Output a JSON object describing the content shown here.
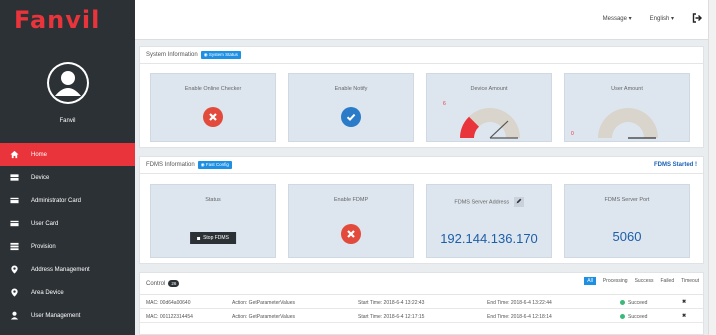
{
  "brand": {
    "logo": "Fanvil",
    "accent": "#e8343a",
    "sidebar_bg": "#2c3136"
  },
  "user": {
    "name": "Fanvil"
  },
  "nav": [
    {
      "label": "Home",
      "icon": "home-icon",
      "active": true
    },
    {
      "label": "Device",
      "icon": "device-icon"
    },
    {
      "label": "Administrator Card",
      "icon": "card-icon"
    },
    {
      "label": "User Card",
      "icon": "card-icon"
    },
    {
      "label": "Provision",
      "icon": "list-icon"
    },
    {
      "label": "Address Management",
      "icon": "location-icon"
    },
    {
      "label": "Area Device",
      "icon": "location-icon"
    },
    {
      "label": "User Management",
      "icon": "user-icon"
    }
  ],
  "topbar": {
    "message": "Message ▾",
    "language": "English ▾",
    "logout_icon": "logout-icon"
  },
  "system": {
    "title": "System Information",
    "tag": "System Status",
    "cards": {
      "online_checker": "Enable Online Checker",
      "notify": "Enable Notify",
      "device_amount": "Device Amount",
      "device_amount_value": "6",
      "user_amount": "User Amount",
      "user_amount_value": "0"
    }
  },
  "fdms": {
    "title": "FDMS Information",
    "tag": "Fast Config",
    "state": "FDMS Started !",
    "cards": {
      "status": "Status",
      "stop_button": "Stop FDMS",
      "enable": "Enable FDMP",
      "server_address": "FDMS Server Address",
      "server_address_value": "192.144.136.170",
      "server_port": "FDMS Server Port",
      "server_port_value": "5060"
    }
  },
  "control": {
    "title": "Control",
    "count": "26",
    "filters": [
      "All",
      "Processing",
      "Success",
      "Failed",
      "Timeout"
    ],
    "rows": [
      {
        "mac": "MAC: 00d64a00640",
        "action": "Action: GetParameterValues",
        "start": "Start Time: 2018-6-4 13:22:43",
        "end": "End Time: 2018-6-4 13:22:44",
        "status": "Succeed"
      },
      {
        "mac": "MAC: 001122314454",
        "action": "Action: GetParameterValues",
        "start": "Start Time: 2018-6-4 12:17:15",
        "end": "End Time: 2018-6-4 12:18:14",
        "status": "Succeed"
      }
    ]
  }
}
